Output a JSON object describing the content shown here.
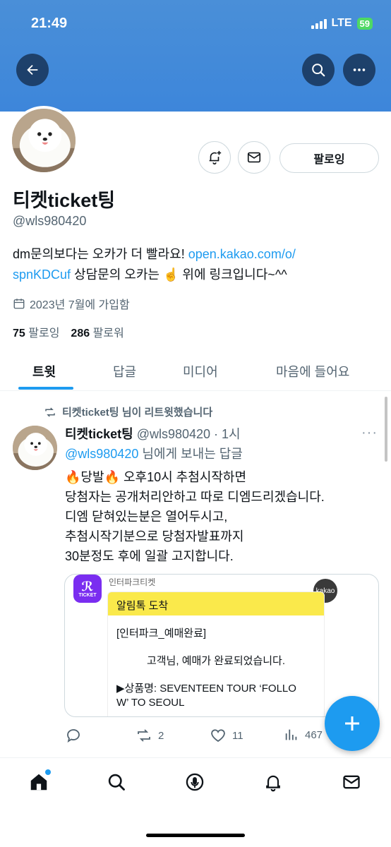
{
  "status": {
    "time": "21:49",
    "network": "LTE",
    "battery": "59"
  },
  "profile": {
    "name": "티켓ticket팅",
    "handle": "@wls980420",
    "bio_text1": "dm문의보다는 오카가 더 빨라요! ",
    "bio_link1": "open.kakao.com/o/",
    "bio_link2": "spnKDCuf",
    "bio_text2": " 상담문의 오카는 ☝️ 위에 링크입니다~^^",
    "joined": "2023년 7월에 가입함",
    "following_count": "75",
    "following_label": "팔로잉",
    "followers_count": "286",
    "followers_label": "팔로워",
    "follow_button": "팔로잉"
  },
  "tabs": [
    "트윗",
    "답글",
    "미디어",
    "마음에 들어요"
  ],
  "tweet": {
    "retweet_text": "티켓ticket팅 님이 리트윗했습니다",
    "author": "티켓ticket팅",
    "handle_time": "@wls980420 · 1시",
    "more": "···",
    "reply_handle": "@wls980420",
    "reply_suffix": " 님에게 보내는 답글",
    "body": "🔥당발🔥 오후10시 추첨시작하면\n당첨자는 공개처리안하고 따로 디엠드리겠습니다.\n디엠 닫혀있는분은 열어두시고,\n추첨시작기분으로 당첨자발표까지\n30분정도 후에 일괄 고지합니다.",
    "media": {
      "sender": "인터파크티켓",
      "app_label": "TICKET",
      "kakao": "kakao",
      "header": "알림톡 도착",
      "line1": "[인터파크_예매완료]",
      "line2": "고객님, 예매가 완료되었습니다.",
      "line3": "▶상품명: SEVENTEEN TOUR ‘FOLLO",
      "line4": "W’ TO SEOUL"
    },
    "retweets": "2",
    "likes": "11",
    "views": "467"
  },
  "colors": {
    "banner": "#3d86da",
    "accent": "#1d9bf0",
    "kakao_yellow": "#fae94b",
    "ticket_purple": "#7a2df0"
  }
}
